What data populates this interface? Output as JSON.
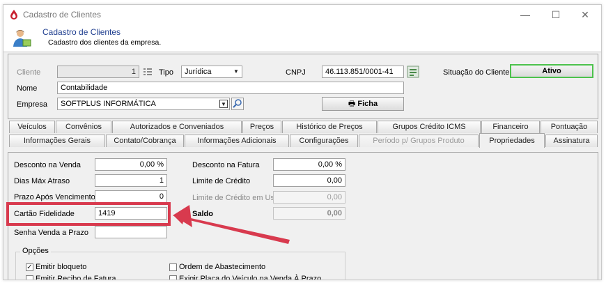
{
  "window": {
    "title": "Cadastro de Clientes",
    "minimize_glyph": "—",
    "maximize_glyph": "☐",
    "close_glyph": "✕"
  },
  "header": {
    "title": "Cadastro de Clientes",
    "subtitle": "Cadastro dos clientes da empresa."
  },
  "form": {
    "cliente_label": "Cliente",
    "cliente_value": "1",
    "tipo_label": "Tipo",
    "tipo_value": "Jurídica",
    "cnpj_label": "CNPJ",
    "cnpj_value": "46.113.851/0001-41",
    "situacao_label": "Situação do Cliente",
    "situacao_value": "Ativo",
    "nome_label": "Nome",
    "nome_value": "Contabilidade",
    "empresa_label": "Empresa",
    "empresa_value": "SOFTPLUS INFORMÁTICA",
    "ficha_label": "Ficha"
  },
  "tabs_row1": [
    "Veículos",
    "Convênios",
    "Autorizados e Conveniados",
    "Preços",
    "Histórico de Preços",
    "Grupos Crédito ICMS",
    "Financeiro",
    "Pontuação"
  ],
  "tabs_row2": [
    "Informações Gerais",
    "Contato/Cobrança",
    "Informações Adicionais",
    "Configurações",
    "Período p/ Grupos Produto",
    "Propriedades",
    "Assinatura"
  ],
  "properties": {
    "desconto_venda_label": "Desconto na Venda",
    "desconto_venda_value": "0,00 %",
    "dias_atraso_label": "Dias Máx Atraso",
    "dias_atraso_value": "1",
    "prazo_vencimento_label": "Prazo Após Vencimento",
    "prazo_vencimento_value": "0",
    "cartao_fidelidade_label": "Cartão Fidelidade",
    "cartao_fidelidade_value": "1419",
    "senha_venda_label": "Senha Venda a Prazo",
    "senha_venda_value": "",
    "desconto_fatura_label": "Desconto na Fatura",
    "desconto_fatura_value": "0,00 %",
    "limite_credito_label": "Limite de Crédito",
    "limite_credito_value": "0,00",
    "limite_uso_label": "Limite de Crédito em Uso",
    "limite_uso_value": "0,00",
    "saldo_label": "Saldo",
    "saldo_value": "0,00"
  },
  "opcoes": {
    "title": "Opções",
    "emitir_bloqueto": "Emitir bloqueto",
    "emitir_recibo": "Emitir Recibo de Fatura",
    "ordem_abastecimento": "Ordem de Abastecimento",
    "exigir_placa": "Exigir Placa do Veículo na Venda À Prazo",
    "check_glyph": "✓"
  },
  "colors": {
    "title_blue": "#1f3e8f",
    "annotation_red": "#d83a4e",
    "status_green": "#4cc24c"
  }
}
